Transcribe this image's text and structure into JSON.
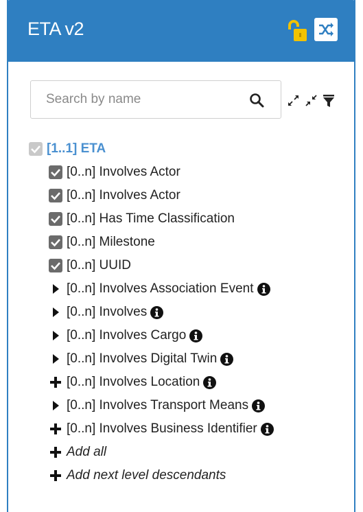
{
  "header": {
    "title": "ETA v2",
    "accent_color": "#2f7fc1",
    "lock_icon": "unlocked-padlock-icon",
    "shuffle_icon": "shuffle-icon"
  },
  "search": {
    "placeholder": "Search by name",
    "value": "",
    "icon": "search-icon"
  },
  "toolbar": {
    "expand_icon": "expand-arrows-icon",
    "collapse_icon": "collapse-arrows-icon",
    "filter_icon": "filter-icon"
  },
  "tree": {
    "root": {
      "label": "[1..1] ETA",
      "checked": true,
      "disabled": true
    },
    "items": [
      {
        "label": "[0..n] Involves Actor",
        "control": "checkbox",
        "checked": true,
        "info": false
      },
      {
        "label": "[0..n] Involves Actor",
        "control": "checkbox",
        "checked": true,
        "info": false
      },
      {
        "label": "[0..n] Has Time Classification",
        "control": "checkbox",
        "checked": true,
        "info": false
      },
      {
        "label": "[0..n] Milestone",
        "control": "checkbox",
        "checked": true,
        "info": false
      },
      {
        "label": "[0..n] UUID",
        "control": "checkbox",
        "checked": true,
        "info": false
      },
      {
        "label": "[0..n] Involves Association Event",
        "control": "caret",
        "info": true
      },
      {
        "label": "[0..n] Involves",
        "control": "caret",
        "info": true
      },
      {
        "label": "[0..n] Involves Cargo",
        "control": "caret",
        "info": true
      },
      {
        "label": "[0..n] Involves Digital Twin",
        "control": "caret",
        "info": true
      },
      {
        "label": "[0..n] Involves Location",
        "control": "plus",
        "info": true
      },
      {
        "label": "[0..n] Involves Transport Means",
        "control": "caret",
        "info": true
      },
      {
        "label": "[0..n] Involves Business Identifier",
        "control": "plus",
        "info": true
      }
    ],
    "actions": [
      {
        "label": "Add all",
        "icon": "plus-icon"
      },
      {
        "label": "Add next level descendants",
        "icon": "plus-icon"
      }
    ]
  }
}
